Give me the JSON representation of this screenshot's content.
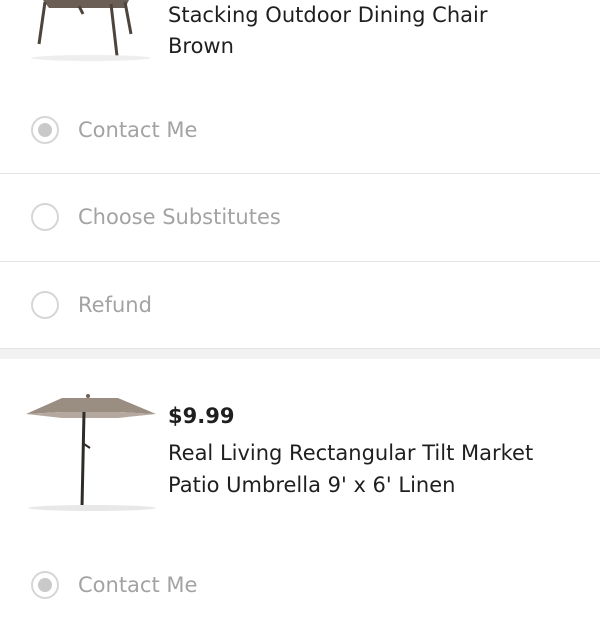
{
  "item1": {
    "name_line1": "Stacking Outdoor Dining Chair",
    "name_line2": "Brown"
  },
  "item1_options": {
    "selected": "Contact Me",
    "contact": "Contact Me",
    "substitutes": "Choose Substitutes",
    "refund": "Refund"
  },
  "item2": {
    "price": "$9.99",
    "name_line1": "Real Living Rectangular Tilt Market",
    "name_line2": "Patio Umbrella 9' x 6' Linen"
  },
  "item2_options": {
    "selected": "Contact Me",
    "contact": "Contact Me"
  },
  "colors": {
    "text": "#1f1f1f",
    "muted": "#a3a3a3",
    "radio_border": "#d6d6d6",
    "divider": "#e3e3e3"
  }
}
